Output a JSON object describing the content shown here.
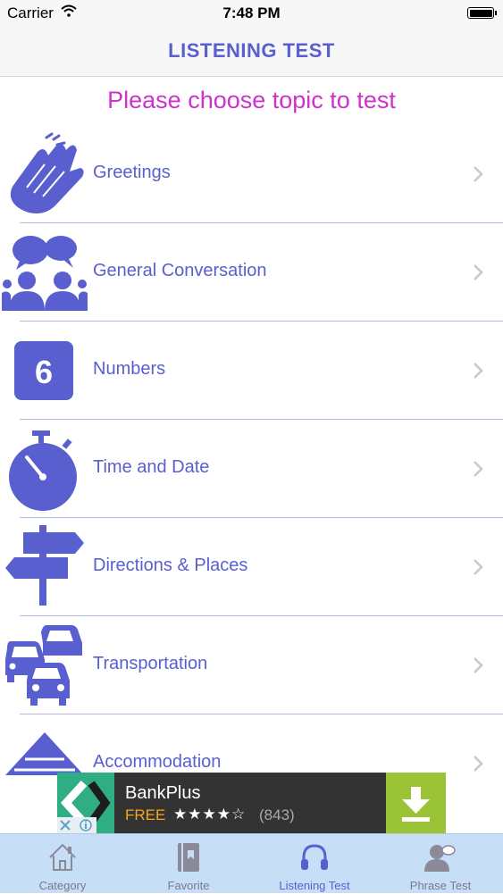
{
  "status_bar": {
    "carrier": "Carrier",
    "time": "7:48 PM"
  },
  "nav": {
    "title": "LISTENING TEST"
  },
  "subtitle": "Please choose topic to test",
  "topics": [
    {
      "label": "Greetings",
      "icon": "clapping-hands-icon"
    },
    {
      "label": "General Conversation",
      "icon": "people-talking-icon"
    },
    {
      "label": "Numbers",
      "icon": "number-six-icon",
      "glyph": "6"
    },
    {
      "label": "Time and Date",
      "icon": "stopwatch-icon"
    },
    {
      "label": "Directions & Places",
      "icon": "signpost-icon"
    },
    {
      "label": "Transportation",
      "icon": "cars-icon"
    },
    {
      "label": "Accommodation",
      "icon": "tent-icon"
    }
  ],
  "ad": {
    "app_name": "BankPlus",
    "price": "FREE",
    "rating": 4.5,
    "stars": "★★★★☆",
    "review_count": "(843)"
  },
  "tabs": [
    {
      "label": "Category",
      "icon": "house-icon"
    },
    {
      "label": "Favorite",
      "icon": "book-icon"
    },
    {
      "label": "Listening Test",
      "icon": "headphones-icon",
      "active": true
    },
    {
      "label": "Phrase Test",
      "icon": "person-speech-icon"
    }
  ],
  "colors": {
    "accent": "#5a5fd0",
    "subtitle": "#cc33cc",
    "tabbar": "#c6def6",
    "ad_logo": "#2fae86",
    "ad_download": "#9ac335"
  }
}
